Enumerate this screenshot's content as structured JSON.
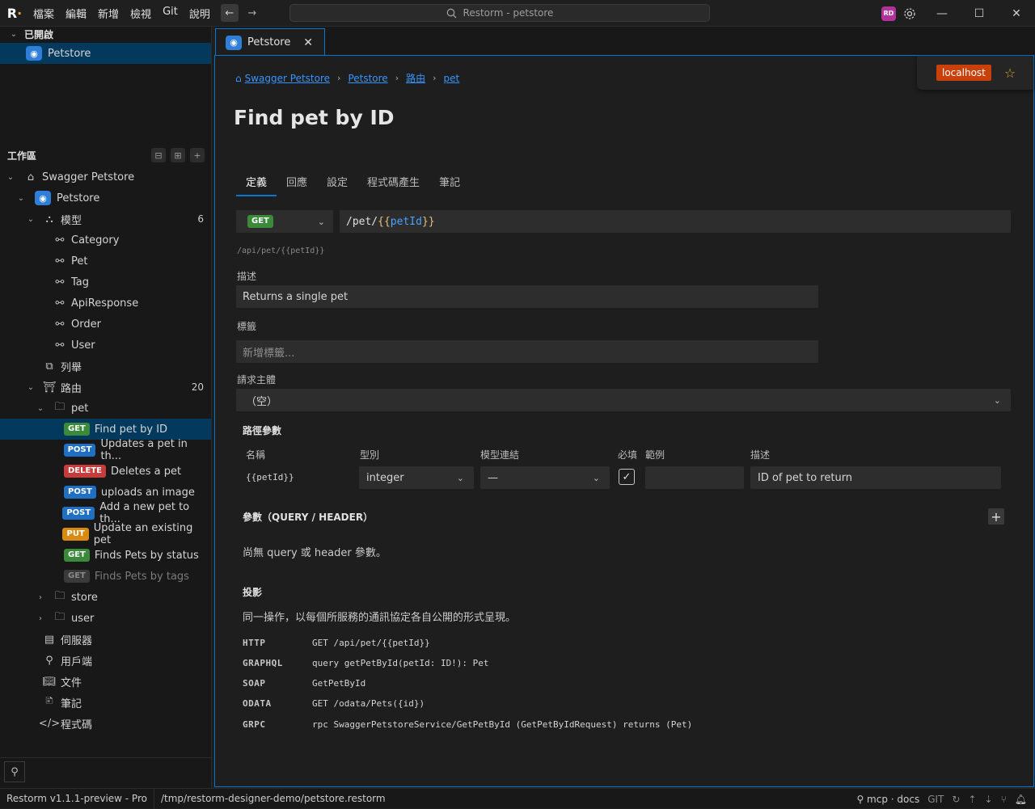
{
  "menu": [
    "檔案",
    "編輯",
    "新增",
    "檢視",
    "Git",
    "說明"
  ],
  "search": {
    "text": "Restorm - petstore"
  },
  "user": {
    "initials": "RD"
  },
  "sidebar": {
    "open_title": "已開啟",
    "open_item": "Petstore",
    "workspace_title": "工作區",
    "tree": {
      "root": "Swagger Petstore",
      "project": "Petstore",
      "models_label": "模型",
      "models_count": "6",
      "models": [
        "Category",
        "Pet",
        "Tag",
        "ApiResponse",
        "Order",
        "User"
      ],
      "enums_label": "列舉",
      "routes_label": "路由",
      "routes_count": "20",
      "folder_pet": "pet",
      "routes": [
        {
          "method": "GET",
          "name": "Find pet by ID"
        },
        {
          "method": "POST",
          "name": "Updates a pet in th..."
        },
        {
          "method": "DELETE",
          "name": "Deletes a pet"
        },
        {
          "method": "POST",
          "name": "uploads an image"
        },
        {
          "method": "POST",
          "name": "Add a new pet to th..."
        },
        {
          "method": "PUT",
          "name": "Update an existing pet"
        },
        {
          "method": "GET",
          "name": "Finds Pets by status"
        },
        {
          "method": "GET",
          "name": "Finds Pets by tags"
        }
      ],
      "folder_store": "store",
      "folder_user": "user",
      "servers": "伺服器",
      "clients": "用戶端",
      "docs": "文件",
      "notes": "筆記",
      "code": "程式碼"
    }
  },
  "tab": {
    "label": "Petstore"
  },
  "server": {
    "label": "localhost"
  },
  "breadcrumb": [
    "Swagger Petstore",
    "Petstore",
    "路由",
    "pet"
  ],
  "page": {
    "title": "Find pet by ID"
  },
  "subtabs": [
    "定義",
    "回應",
    "設定",
    "程式碼產生",
    "筆記"
  ],
  "request": {
    "method": "GET",
    "url_prefix": "/pet/",
    "url_open": "{{",
    "url_var": "petId",
    "url_close": "}}",
    "resolved": "/api/pet/{{petId}}"
  },
  "fields": {
    "desc_label": "描述",
    "desc_value": "Returns a single pet",
    "tags_label": "標籤",
    "tags_placeholder": "新增標籤...",
    "body_label": "請求主體",
    "body_value": "（空）"
  },
  "path_params": {
    "title": "路徑參數",
    "headers": [
      "名稱",
      "型別",
      "模型連結",
      "必填",
      "範例",
      "描述"
    ],
    "row": {
      "name": "{{petId}}",
      "type": "integer",
      "model": "—",
      "required": "✓",
      "example": "",
      "desc": "ID of pet to return"
    }
  },
  "query_params": {
    "title": "參數（QUERY / HEADER）",
    "empty": "尚無 query 或 header 參數。"
  },
  "projection": {
    "title": "投影",
    "desc": "同一操作，以每個所服務的通訊協定各自公開的形式呈現。",
    "rows": [
      {
        "k": "HTTP",
        "v": "GET /api/pet/{{petId}}"
      },
      {
        "k": "GRAPHQL",
        "v": "query getPetById(petId: ID!): Pet"
      },
      {
        "k": "SOAP",
        "v": "GetPetById"
      },
      {
        "k": "ODATA",
        "v": "GET /odata/Pets({id})"
      },
      {
        "k": "GRPC",
        "v": "rpc SwaggerPetstoreService/GetPetById (GetPetByIdRequest) returns (Pet)"
      }
    ]
  },
  "status": {
    "version": "Restorm v1.1.1-preview - Pro",
    "path": "/tmp/restorm-designer-demo/petstore.restorm",
    "mcp": "mcp · docs",
    "git": "GIT"
  }
}
